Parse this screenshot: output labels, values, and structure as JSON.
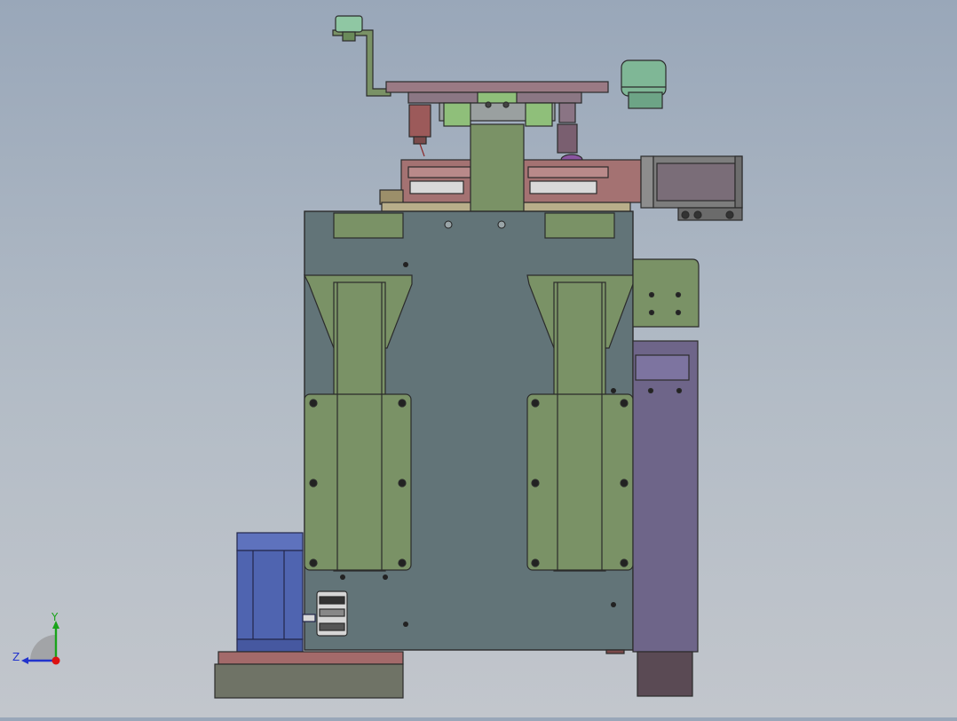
{
  "viewport": {
    "background_top": "#99a7b9",
    "background_bottom": "#c2c6cc",
    "view": "front"
  },
  "triad": {
    "y_label": "Y",
    "z_label": "Z",
    "y_color": "#1aa31a",
    "z_color": "#2233cc",
    "origin_color": "#dd1111"
  },
  "model": {
    "frame_color": "#627478",
    "bracket_color": "#7a9266",
    "panel_color": "#6e6589",
    "slide_color": "#9c6a6a",
    "servo_color": "#7d7d7d",
    "motor_color": "#4f64b0",
    "pulley_color": "#7fb796",
    "base_color": "#6f7366",
    "feet_color": "#5a4a54"
  }
}
